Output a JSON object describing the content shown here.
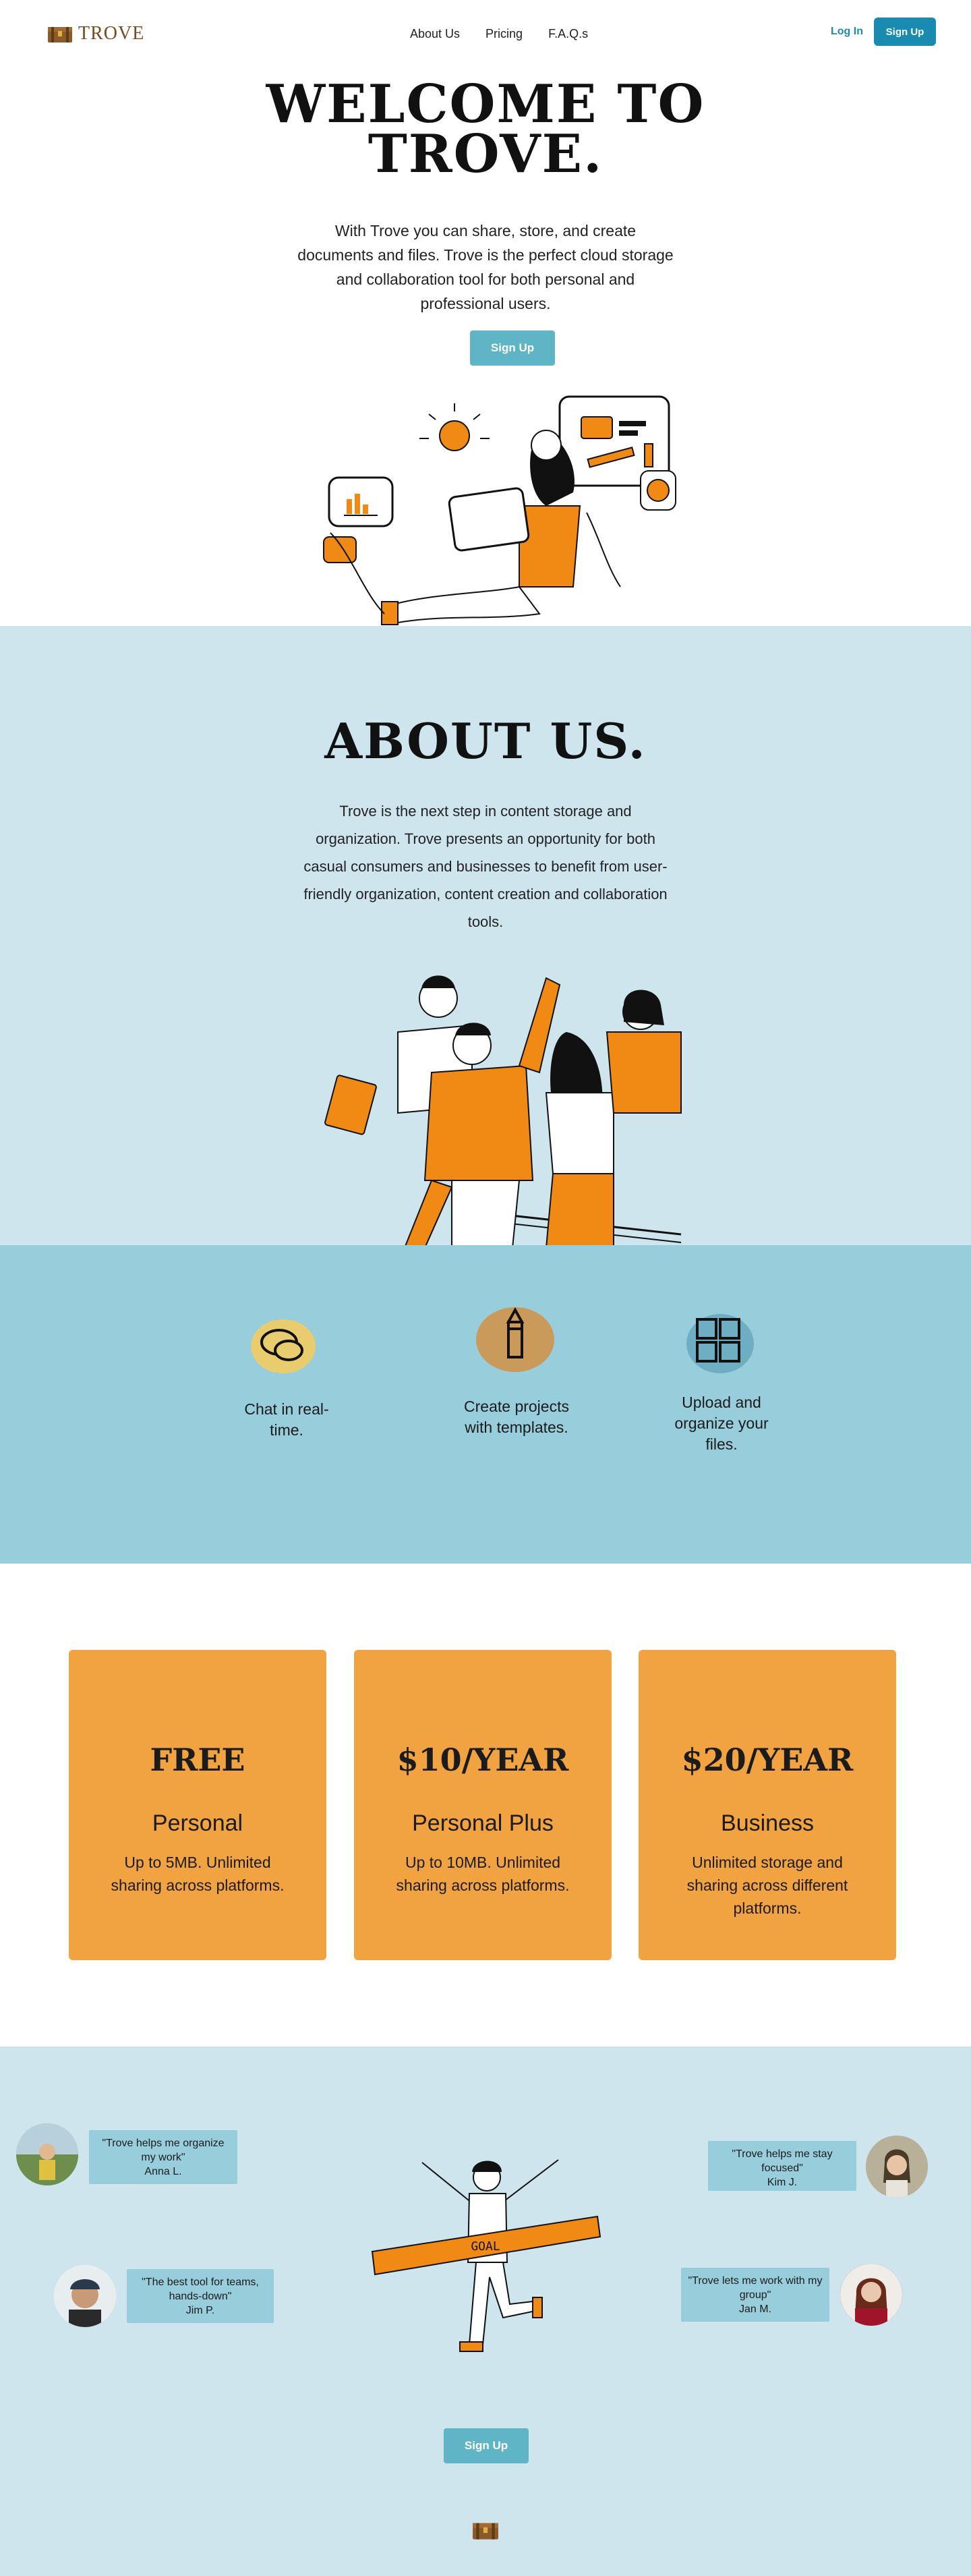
{
  "brand": {
    "name": "TROVE"
  },
  "nav": {
    "links": [
      "About Us",
      "Pricing",
      "F.A.Q.s"
    ],
    "login": "Log In",
    "signup": "Sign Up"
  },
  "hero": {
    "title_line1": "Welcome to",
    "title_line2": "Trove.",
    "description": "With Trove you can share, store, and create documents and files. Trove is the perfect cloud storage and collaboration tool for both personal and professional users.",
    "cta": "Sign Up"
  },
  "about": {
    "title": "About us.",
    "description": "Trove is the next step in content storage and organization. Trove presents an opportunity for both casual consumers and businesses to benefit from user-friendly organization, content creation and collaboration tools."
  },
  "features": [
    {
      "icon": "chat-bubbles-icon",
      "label": "Chat in real-time."
    },
    {
      "icon": "pencil-icon",
      "label": "Create projects with templates."
    },
    {
      "icon": "grid-icon",
      "label": "Upload and organize your files."
    }
  ],
  "pricing": [
    {
      "price": "FREE",
      "plan": "Personal",
      "desc": "Up to 5MB. Unlimited sharing across platforms."
    },
    {
      "price": "$10/YEAR",
      "plan": "Personal Plus",
      "desc": "Up to 10MB. Unlimited sharing across platforms."
    },
    {
      "price": "$20/YEAR",
      "plan": "Business",
      "desc": "Unlimited storage and sharing across different platforms."
    }
  ],
  "testimonials": [
    {
      "quote": "\"Trove helps me organize my work\"",
      "author": "Anna L."
    },
    {
      "quote": "\"The best tool for teams, hands-down\"",
      "author": "Jim P."
    },
    {
      "quote": "\"Trove helps me stay focused\"",
      "author": "Kim J."
    },
    {
      "quote": "\"Trove lets me work with my group\"",
      "author": "Jan M."
    }
  ],
  "goal_banner": "GOAL",
  "footer": {
    "cta": "Sign Up"
  },
  "colors": {
    "accent": "#f2a341",
    "orange": "#f08a14",
    "blue": "#198ab0",
    "light_blue": "#cee5ed",
    "mid_blue": "#98cddc",
    "brown": "#7a4a1e"
  }
}
